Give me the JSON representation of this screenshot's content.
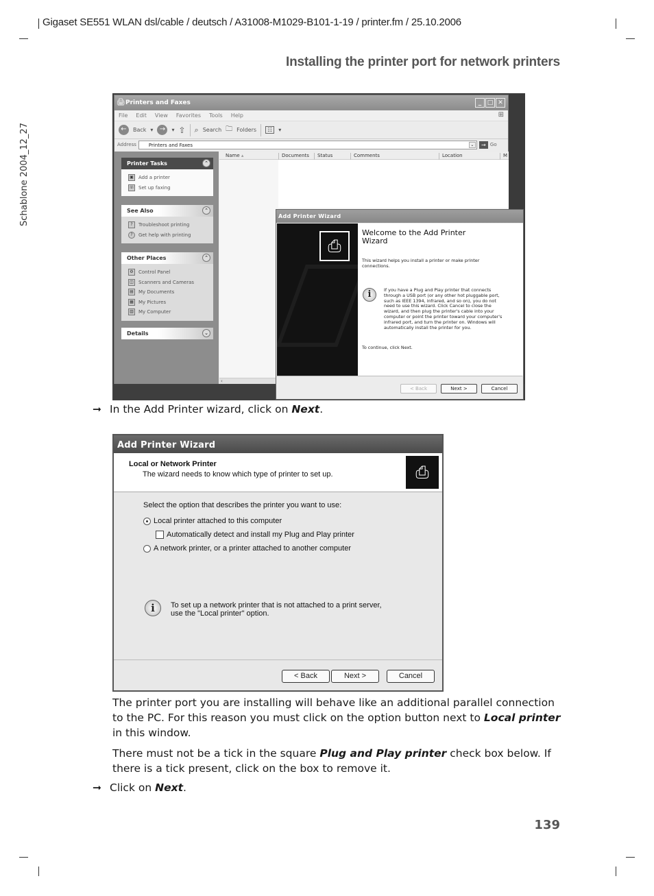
{
  "page": {
    "header_line": "Gigaset SE551 WLAN dsl/cable / deutsch / A31008-M1029-B101-1-19 / printer.fm / 25.10.2006",
    "section_title": "Installing the printer port for network printers",
    "side_label": "Schablone 2004_12_27",
    "page_number": "139"
  },
  "explorer": {
    "title": "Printers and Faxes",
    "menu": [
      "File",
      "Edit",
      "View",
      "Favorites",
      "Tools",
      "Help"
    ],
    "toolbar": {
      "back": "Back",
      "search": "Search",
      "folders": "Folders"
    },
    "address_label": "Address",
    "address_value": "Printers and Faxes",
    "go_label": "Go",
    "columns": [
      "Name",
      "Documents",
      "Status",
      "Comments",
      "Location",
      "M"
    ],
    "panels": [
      {
        "title": "Printer Tasks",
        "items": [
          "Add a printer",
          "Set up faxing"
        ]
      },
      {
        "title": "See Also",
        "items": [
          "Troubleshoot printing",
          "Get help with printing"
        ]
      },
      {
        "title": "Other Places",
        "items": [
          "Control Panel",
          "Scanners and Cameras",
          "My Documents",
          "My Pictures",
          "My Computer"
        ]
      },
      {
        "title": "Details",
        "items": []
      }
    ]
  },
  "wizard1": {
    "title": "Add Printer Wizard",
    "heading": "Welcome to the Add Printer Wizard",
    "intro": "This wizard helps you install a printer or make printer connections.",
    "info": "If you have a Plug and Play printer that connects through a USB port (or any other hot pluggable port, such as IEEE 1394, infrared, and so on), you do not need to use this wizard. Click Cancel to close the wizard, and then plug the printer's cable into your computer or point the printer toward your computer's infrared port, and turn the printer on. Windows will automatically install the printer for you.",
    "continue": "To continue, click Next.",
    "buttons": {
      "back": "< Back",
      "next": "Next >",
      "cancel": "Cancel"
    }
  },
  "instruction1": {
    "prefix": "In the Add Printer wizard, click on ",
    "emph": "Next",
    "suffix": "."
  },
  "wizard2": {
    "title": "Add Printer Wizard",
    "heading": "Local or Network Printer",
    "subheading": "The wizard needs to know which type of printer to set up.",
    "prompt": "Select the option that describes the printer you want to use:",
    "options": [
      {
        "label": "Local printer attached to this computer",
        "selected": true
      },
      {
        "label": "A network printer, or a printer attached to another computer",
        "selected": false
      }
    ],
    "checkbox": {
      "label": "Automatically detect and install my Plug and Play printer",
      "checked": false
    },
    "info_line1": "To set up a network printer that is not attached to a print server,",
    "info_line2": "use the \"Local printer\" option.",
    "buttons": {
      "back": "< Back",
      "next": "Next >",
      "cancel": "Cancel"
    }
  },
  "para1": {
    "a": "The printer port you are installing will behave like an additional parallel connection to the PC. For this reason you must click on the option button next to ",
    "emph": "Local printer",
    "b": " in this window."
  },
  "para2": {
    "a": "There must not be a tick in the square ",
    "emph": "Plug and Play printer",
    "b": " check box below. If there is a tick present, click on the box to remove it."
  },
  "instruction2": {
    "prefix": "Click on ",
    "emph": "Next",
    "suffix": "."
  },
  "icons": {
    "arrow": "➞"
  }
}
